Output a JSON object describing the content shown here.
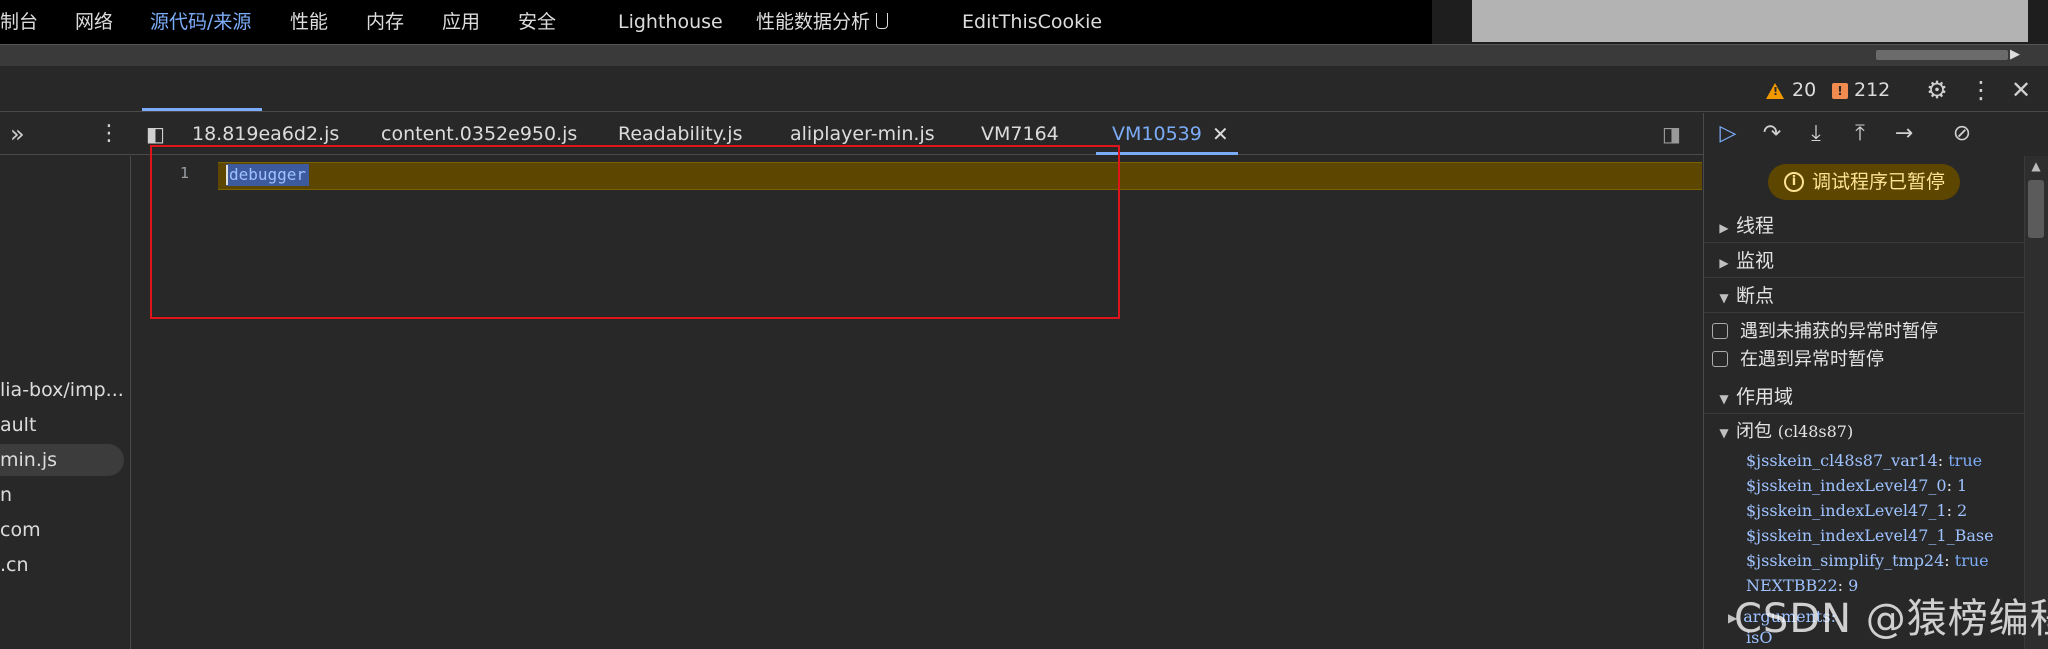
{
  "main_tabs": [
    {
      "label": "制台",
      "active": false
    },
    {
      "label": "网络",
      "active": false
    },
    {
      "label": "源代码/来源",
      "active": true
    },
    {
      "label": "性能",
      "active": false
    },
    {
      "label": "内存",
      "active": false
    },
    {
      "label": "应用",
      "active": false
    },
    {
      "label": "安全",
      "active": false
    },
    {
      "label": "Lighthouse",
      "active": false
    },
    {
      "label": "性能数据分析",
      "active": false
    },
    {
      "label": "EditThisCookie",
      "active": false
    }
  ],
  "status": {
    "warnings": "20",
    "errors": "212"
  },
  "file_tabs": [
    {
      "label": "18.819ea6d2.js",
      "active": false
    },
    {
      "label": "content.0352e950.js",
      "active": false
    },
    {
      "label": "Readability.js",
      "active": false
    },
    {
      "label": "aliplayer-min.js",
      "active": false
    },
    {
      "label": "VM7164",
      "active": false
    },
    {
      "label": "VM10539",
      "active": true
    }
  ],
  "navigator_items": [
    {
      "label": "lia-box/imp..."
    },
    {
      "label": "ault"
    },
    {
      "label": "min.js",
      "selected": true
    },
    {
      "label": "n"
    },
    {
      "label": "com"
    },
    {
      "label": ".cn"
    }
  ],
  "editor": {
    "line_number": "1",
    "code": "debugger"
  },
  "debugger": {
    "paused_text": "调试程序已暂停",
    "sections": {
      "threads": "线程",
      "watch": "监视",
      "breakpoints": "断点",
      "scope": "作用域"
    },
    "options": [
      {
        "label": "遇到未捕获的异常时暂停",
        "checked": false
      },
      {
        "label": "在遇到异常时暂停",
        "checked": false
      }
    ],
    "closure_label": "闭包",
    "closure_id": "(cl48s87)",
    "scope_vars": [
      {
        "key": "$jsskein_cl48s87_var14",
        "value": "true"
      },
      {
        "key": "$jsskein_indexLevel47_0",
        "value": "1"
      },
      {
        "key": "$jsskein_indexLevel47_1",
        "value": "2"
      },
      {
        "key": "$jsskein_indexLevel47_1_Base",
        "value": ""
      },
      {
        "key": "$jsskein_simplify_tmp24",
        "value": "true"
      },
      {
        "key": "NEXTBB22",
        "value": "9"
      }
    ],
    "extra_key": "arguments",
    "last_key": "isO"
  },
  "watermark": "CSDN @猿榜编程",
  "colors": {
    "accent": "#7cacf8",
    "paused_line": "#5c4600",
    "highlight_box": "#e0151b"
  }
}
